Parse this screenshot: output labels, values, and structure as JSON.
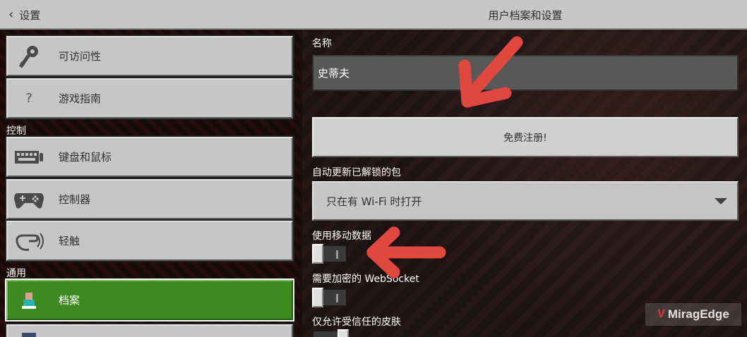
{
  "header": {
    "back_label": "设置",
    "title": "用户档案和设置"
  },
  "sidebar": {
    "items": [
      {
        "label": "可访问性",
        "icon": "key-icon"
      },
      {
        "label": "游戏指南",
        "icon": "question-icon",
        "icon_glyph": "?"
      },
      {
        "label": "键盘和鼠标",
        "icon": "keyboard-icon"
      },
      {
        "label": "控制器",
        "icon": "gamepad-icon"
      },
      {
        "label": "轻触",
        "icon": "touch-icon"
      },
      {
        "label": "档案",
        "icon": "profile-icon",
        "active": true
      }
    ],
    "sections": {
      "controls": "控制",
      "general": "通用"
    }
  },
  "profile": {
    "name_label": "名称",
    "name_value": "史蒂夫",
    "signup_label": "免费注册!",
    "auto_update_label": "自动更新已解锁的包",
    "auto_update_value": "只在有 Wi-Fi 时打开",
    "mobile_data_label": "使用移动数据",
    "websocket_label": "需要加密的 WebSocket",
    "trusted_skins_label": "仅允许受信任的皮肤"
  },
  "watermark": {
    "text": "MiragEdge",
    "mark": "V"
  },
  "colors": {
    "active_green": "#3c8a20",
    "button_gray": "#c6c6c6",
    "arrow_red": "#e0473f"
  }
}
